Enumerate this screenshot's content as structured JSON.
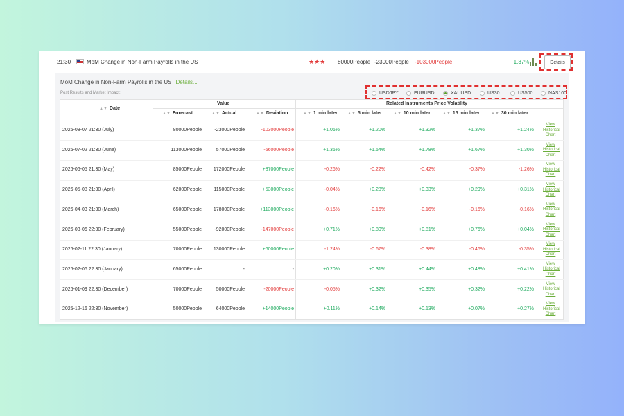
{
  "event": {
    "time": "21:30",
    "flag_country": "US",
    "title": "MoM Change in Non-Farm Payrolls in the US",
    "stars": "★★★",
    "forecast": "80000People",
    "actual": "-23000People",
    "deviation": "-103000People",
    "change": "+1.37%",
    "details_label": "Details"
  },
  "panel": {
    "title": "MoM Change in Non-Farm Payrolls in the US",
    "details_link": "Details...",
    "subtitle": "Post Results and Market Impact:"
  },
  "instruments": {
    "selected": "XAUUSD",
    "options": [
      "USDJPY",
      "EURUSD",
      "XAUUSD",
      "US30",
      "US500",
      "NAS100"
    ]
  },
  "table": {
    "group_value": "Value",
    "group_volatility": "Related Instruments Price Volatility",
    "headers": {
      "date": "Date",
      "forecast": "Forecast",
      "actual": "Actual",
      "deviation": "Deviation",
      "m1": "1 min later",
      "m5": "5 min later",
      "m10": "10 min later",
      "m15": "15 min later",
      "m30": "30 min later"
    },
    "view_label_1": "View",
    "view_label_2": "Historical",
    "view_label_3": "Chart",
    "rows": [
      {
        "date": "2026-08-07 21:30 (July)",
        "forecast": "80000People",
        "actual": "-23000People",
        "deviation": "-103000People",
        "m1": "+1.06%",
        "m5": "+1.20%",
        "m10": "+1.32%",
        "m15": "+1.37%",
        "m30": "+1.24%"
      },
      {
        "date": "2026-07-02 21:30 (June)",
        "forecast": "113000People",
        "actual": "57000People",
        "deviation": "-56000People",
        "m1": "+1.36%",
        "m5": "+1.54%",
        "m10": "+1.78%",
        "m15": "+1.67%",
        "m30": "+1.30%"
      },
      {
        "date": "2026-06-05 21:30 (May)",
        "forecast": "85000People",
        "actual": "172000People",
        "deviation": "+87000People",
        "m1": "-0.26%",
        "m5": "-0.22%",
        "m10": "-0.42%",
        "m15": "-0.37%",
        "m30": "-1.26%"
      },
      {
        "date": "2026-05-08 21:30 (April)",
        "forecast": "62000People",
        "actual": "115000People",
        "deviation": "+53000People",
        "m1": "-0.04%",
        "m5": "+0.28%",
        "m10": "+0.33%",
        "m15": "+0.29%",
        "m30": "+0.31%"
      },
      {
        "date": "2026-04-03 21:30 (March)",
        "forecast": "65000People",
        "actual": "178000People",
        "deviation": "+113000People",
        "m1": "-0.16%",
        "m5": "-0.16%",
        "m10": "-0.16%",
        "m15": "-0.16%",
        "m30": "-0.16%"
      },
      {
        "date": "2026-03-06 22:30 (February)",
        "forecast": "55000People",
        "actual": "-92000People",
        "deviation": "-147000People",
        "m1": "+0.71%",
        "m5": "+0.80%",
        "m10": "+0.81%",
        "m15": "+0.76%",
        "m30": "+0.04%"
      },
      {
        "date": "2026-02-11 22:30 (January)",
        "forecast": "70000People",
        "actual": "130000People",
        "deviation": "+60000People",
        "m1": "-1.24%",
        "m5": "-0.67%",
        "m10": "-0.38%",
        "m15": "-0.46%",
        "m30": "-0.35%"
      },
      {
        "date": "2026-02-06 22:30 (January)",
        "forecast": "65000People",
        "actual": "-",
        "deviation": "-",
        "m1": "+0.20%",
        "m5": "+0.31%",
        "m10": "+0.44%",
        "m15": "+0.48%",
        "m30": "+0.41%"
      },
      {
        "date": "2026-01-09 22:30 (December)",
        "forecast": "70000People",
        "actual": "50000People",
        "deviation": "-20000People",
        "m1": "-0.05%",
        "m5": "+0.32%",
        "m10": "+0.35%",
        "m15": "+0.32%",
        "m30": "+0.22%"
      },
      {
        "date": "2025-12-16 22:30 (November)",
        "forecast": "50000People",
        "actual": "64000People",
        "deviation": "+14000People",
        "m1": "+0.11%",
        "m5": "+0.14%",
        "m10": "+0.13%",
        "m15": "+0.07%",
        "m30": "+0.27%"
      }
    ]
  },
  "colors": {
    "positive": "#1eaa5e",
    "negative": "#e23b3b",
    "link": "#6cae3c",
    "highlight": "#e03030"
  }
}
